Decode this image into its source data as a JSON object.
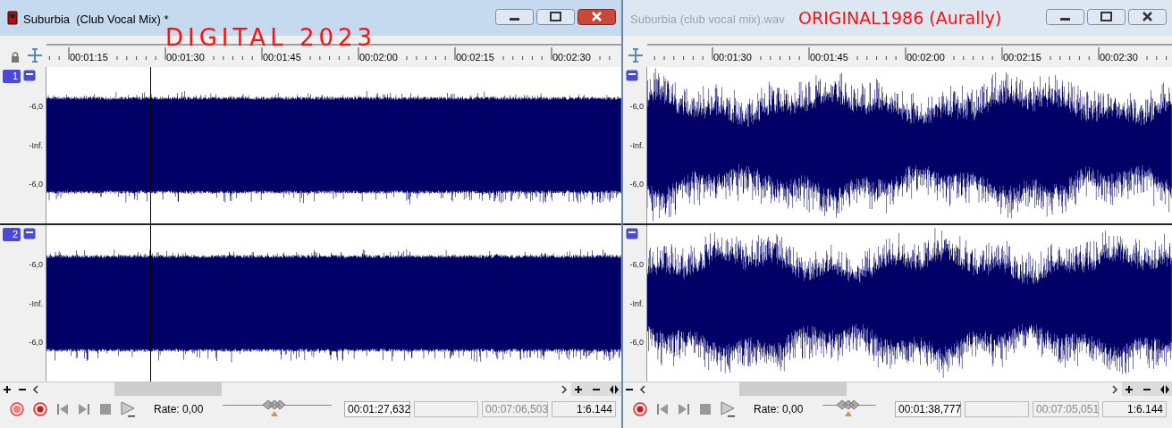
{
  "windows": [
    {
      "title": "Suburbia  (Club Vocal Mix) *",
      "active": true,
      "annotation": "DIGITAL 2023",
      "ruler": [
        "00:01:15",
        "00:01:30",
        "00:01:45",
        "00:02:00",
        "00:02:15",
        "00:02:30"
      ],
      "channels": [
        {
          "number": "1",
          "scale": [
            "-6,0",
            "-Inf.",
            "-6,0"
          ]
        },
        {
          "number": "2",
          "scale": [
            "-6,0",
            "-Inf.",
            "-6,0"
          ]
        }
      ],
      "transport": {
        "rate": "Rate: 0,00",
        "level": 0.47,
        "position": "00:01:27,632",
        "length": "00:07:06,503",
        "zoom": "1:6.144"
      }
    },
    {
      "title": "Suburbia (club vocal mix).wav",
      "active": false,
      "annotation": "ORIGINAL1986 (Aurally)",
      "ruler": [
        "00:01:30",
        "00:01:45",
        "00:02:00",
        "00:02:15",
        "00:02:30"
      ],
      "channels": [
        {
          "scale": [
            "-6,0",
            "-Inf.",
            "-6,0"
          ]
        },
        {
          "scale": [
            "-6,0",
            "-Inf.",
            "-6,0"
          ]
        }
      ],
      "transport": {
        "rate": "Rate: 0,00",
        "level": 0.47,
        "position": "00:01:38,777",
        "length": "00:07:05,051",
        "zoom": "1:6.144"
      }
    }
  ]
}
